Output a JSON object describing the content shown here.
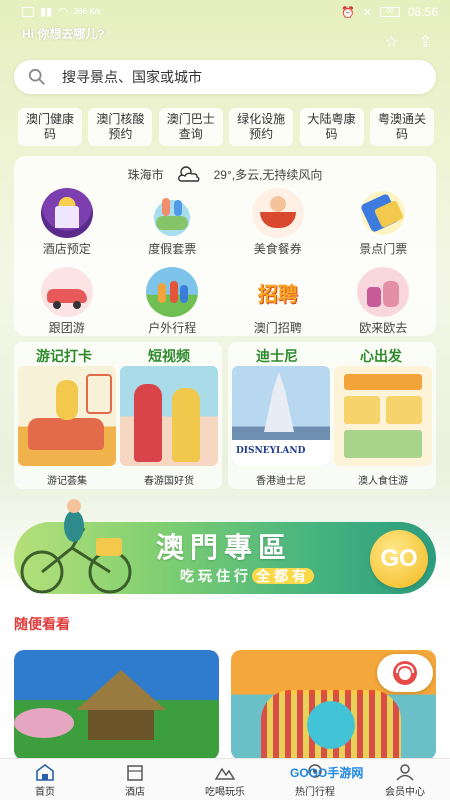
{
  "status": {
    "network_speed": "366 K/s",
    "battery": "80",
    "time": "08:56"
  },
  "greeting": "Hi 你想去哪儿?",
  "search": {
    "placeholder": "搜寻景点、国家或城市"
  },
  "quick_buttons": [
    {
      "label": "澳门健康码"
    },
    {
      "label": "澳门核酸预约"
    },
    {
      "label": "澳门巴士查询"
    },
    {
      "label": "绿化设施预约"
    },
    {
      "label": "大陆粤康码"
    },
    {
      "label": "粤澳通关码"
    }
  ],
  "weather": {
    "city": "珠海市",
    "desc": "29°,多云,无持续风向"
  },
  "services": [
    {
      "label": "酒店预定",
      "icon": "hotel-icon"
    },
    {
      "label": "度假套票",
      "icon": "vacation-icon"
    },
    {
      "label": "美食餐券",
      "icon": "food-icon"
    },
    {
      "label": "景点门票",
      "icon": "ticket-icon"
    },
    {
      "label": "跟团游",
      "icon": "group-tour-icon"
    },
    {
      "label": "户外行程",
      "icon": "outdoor-icon"
    },
    {
      "label": "澳门招聘",
      "icon": "recruit-icon",
      "icon_text": "招聘"
    },
    {
      "label": "欧来欧去",
      "icon": "travel-icon"
    }
  ],
  "features": {
    "left": {
      "title1": "游记打卡",
      "title2": "短视频",
      "cap1": "游记荟集",
      "cap2": "春游国好货"
    },
    "right": {
      "title1": "迪士尼",
      "title2": "心出发",
      "cap1": "香港迪士尼",
      "cap2": "澳人食住游"
    }
  },
  "banner": {
    "title": "澳門專區",
    "subtitle": "吃玩住行",
    "highlight": "全都有",
    "go": "GO"
  },
  "section_title": "随便看看",
  "bottom_nav": [
    {
      "label": "首页",
      "icon": "home-icon"
    },
    {
      "label": "酒店",
      "icon": "hotel-nav-icon"
    },
    {
      "label": "吃喝玩乐",
      "icon": "mountain-icon"
    },
    {
      "label": "热门行程",
      "icon": "route-icon"
    },
    {
      "label": "会员中心",
      "icon": "user-icon"
    }
  ],
  "watermark": "GOGO手游网",
  "colors": {
    "accent_green": "#2d8a2a",
    "section_red": "#e03c3c",
    "go_yellow": "#f2b91c"
  }
}
